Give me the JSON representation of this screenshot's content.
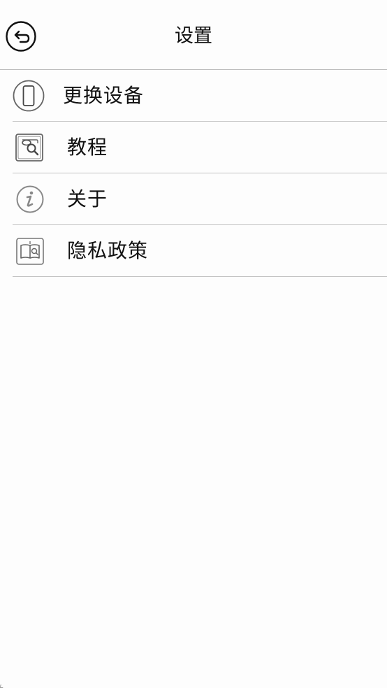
{
  "header": {
    "title": "设置"
  },
  "menu": {
    "items": [
      {
        "label": "更换设备",
        "icon": "phone-icon"
      },
      {
        "label": "教程",
        "icon": "tutorial-icon"
      },
      {
        "label": "关于",
        "icon": "info-icon"
      },
      {
        "label": "隐私政策",
        "icon": "privacy-book-icon"
      }
    ]
  }
}
